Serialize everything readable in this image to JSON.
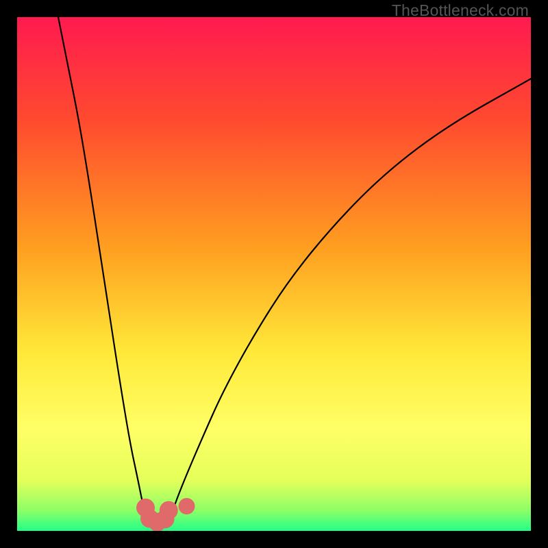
{
  "watermark": "TheBottleneck.com",
  "chart_data": {
    "type": "line",
    "title": "",
    "xlabel": "",
    "ylabel": "",
    "axes_visible": false,
    "grid": false,
    "legend": false,
    "xlim": [
      0,
      100
    ],
    "ylim": [
      0,
      100
    ],
    "background_gradient": {
      "stops": [
        {
          "pos": 0.0,
          "color": "#ff1a4f"
        },
        {
          "pos": 0.2,
          "color": "#ff4a2f"
        },
        {
          "pos": 0.45,
          "color": "#ff9f20"
        },
        {
          "pos": 0.65,
          "color": "#ffe838"
        },
        {
          "pos": 0.8,
          "color": "#ffff66"
        },
        {
          "pos": 0.9,
          "color": "#e5ff5a"
        },
        {
          "pos": 0.96,
          "color": "#8dff66"
        },
        {
          "pos": 1.0,
          "color": "#22ff88"
        }
      ]
    },
    "series": [
      {
        "name": "left-curve",
        "stroke": "#000000",
        "x": [
          8,
          10,
          12,
          14,
          16,
          18,
          20,
          22,
          23.5,
          24.5,
          25.3,
          25.8
        ],
        "y": [
          100,
          90,
          80,
          68,
          55,
          42,
          29,
          17,
          10,
          5,
          2,
          0.8
        ]
      },
      {
        "name": "right-curve",
        "stroke": "#000000",
        "x": [
          29.2,
          30,
          31,
          33,
          36,
          40,
          46,
          53,
          62,
          72,
          84,
          100
        ],
        "y": [
          0.8,
          3,
          6,
          11,
          18,
          27,
          38,
          49,
          60,
          70,
          79,
          88
        ]
      },
      {
        "name": "valley-floor",
        "stroke": "#000000",
        "x": [
          25.8,
          26.5,
          27.3,
          28.2,
          29.2
        ],
        "y": [
          0.8,
          0.5,
          0.5,
          0.6,
          0.8
        ]
      }
    ],
    "markers": [
      {
        "name": "bump-left",
        "cx": 25.0,
        "cy": 4.5,
        "r": 1.8,
        "color": "#e06a6a"
      },
      {
        "name": "bump-bottomL",
        "cx": 25.8,
        "cy": 2.4,
        "r": 1.8,
        "color": "#e06a6a"
      },
      {
        "name": "bump-bottom",
        "cx": 27.3,
        "cy": 1.7,
        "r": 1.8,
        "color": "#e06a6a"
      },
      {
        "name": "bump-bottomR",
        "cx": 28.8,
        "cy": 2.3,
        "r": 1.8,
        "color": "#e06a6a"
      },
      {
        "name": "bump-right",
        "cx": 29.5,
        "cy": 4.0,
        "r": 1.8,
        "color": "#e06a6a"
      },
      {
        "name": "bump-isolated",
        "cx": 33.0,
        "cy": 4.8,
        "r": 1.6,
        "color": "#e06a6a"
      }
    ]
  }
}
